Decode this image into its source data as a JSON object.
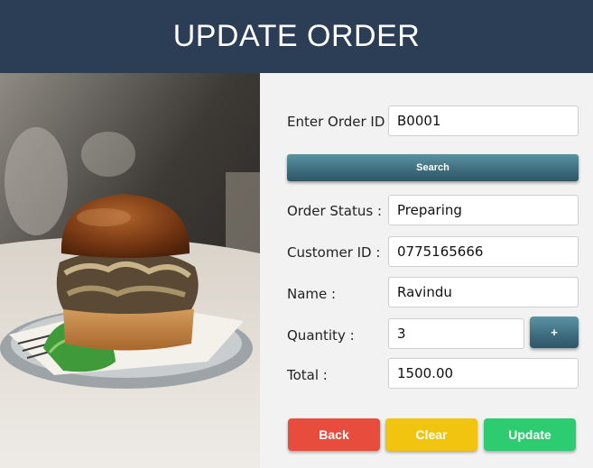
{
  "header": {
    "title": "UPDATE ORDER"
  },
  "form": {
    "order_id": {
      "label": "Enter Order ID :",
      "value": "B0001"
    },
    "search_label": "Search",
    "order_status": {
      "label": "Order Status :",
      "value": "Preparing"
    },
    "customer_id": {
      "label": "Customer ID :",
      "value": "0775165666"
    },
    "name": {
      "label": "Name :",
      "value": "Ravindu"
    },
    "quantity": {
      "label": "Quantity :",
      "value": "3"
    },
    "plus_label": "+",
    "total": {
      "label": "Total :",
      "value": "1500.00"
    }
  },
  "actions": {
    "back": "Back",
    "clear": "Clear",
    "update": "Update"
  },
  "colors": {
    "header_bg": "#2c3e55",
    "back": "#e74c3c",
    "clear": "#f1c40f",
    "update": "#2ecc71",
    "search_button": "#3f6f80"
  },
  "image": {
    "subject": "burger-photo"
  }
}
